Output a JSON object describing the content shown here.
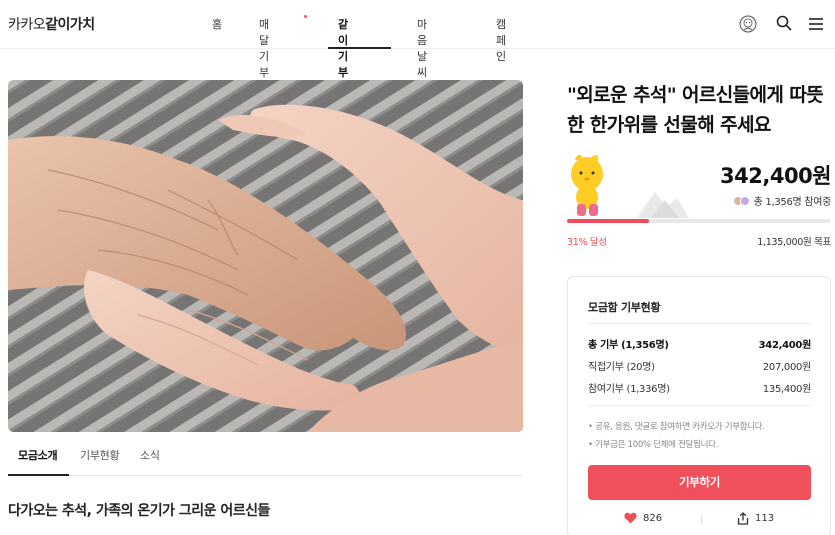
{
  "header": {
    "logo_light": "카카오",
    "logo_bold": "같이가치",
    "nav": [
      "홈",
      "매달기부",
      "같이기부",
      "마음날씨",
      "캠페인"
    ],
    "active_nav": "같이기부"
  },
  "tabs": [
    "모금소개",
    "기부현황",
    "소식"
  ],
  "section_heading": "다가오는 추석, 가족의 온기가 그리운 어르신들",
  "campaign": {
    "title": "\"외로운 추석\" 어르신들에게 따뜻한 한가위를 선물해 주세요",
    "amount": "342,400원",
    "participants": "총 1,356명 참여중",
    "progress_pct_label": "31% 달성",
    "progress_fraction": 0.31,
    "goal": "1,135,000원 목표"
  },
  "status": {
    "title": "모금함 기부현황",
    "rows": [
      {
        "label": "총 기부 (1,356명)",
        "value": "342,400원"
      },
      {
        "label": "직접기부 (20명)",
        "value": "207,000원"
      },
      {
        "label": "참여기부 (1,336명)",
        "value": "135,400원"
      }
    ],
    "notes": [
      "• 공유, 응원, 댓글로 참여하면 카카오가 기부합니다.",
      "• 기부금은 100% 단체에 전달됩니다."
    ],
    "donate_label": "기부하기",
    "likes": "826",
    "shares": "113"
  },
  "colors": {
    "accent": "#f0505c",
    "progress": "#f04b5a"
  },
  "icons": [
    "profile-icon",
    "search-icon",
    "menu-icon",
    "heart-icon",
    "share-icon"
  ]
}
